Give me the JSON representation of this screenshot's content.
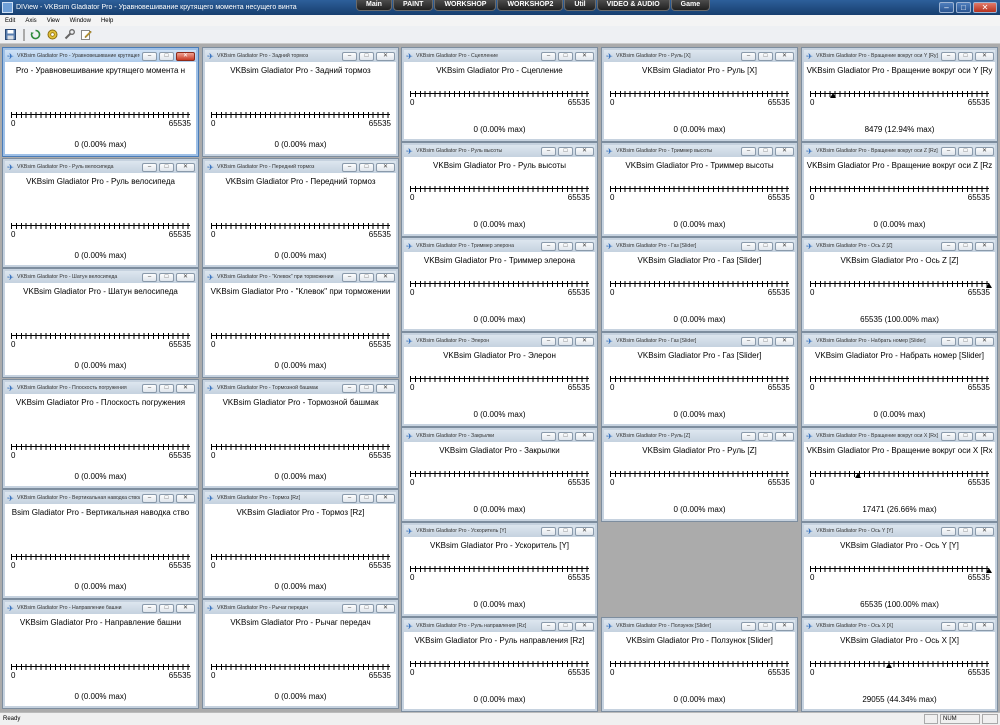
{
  "app": {
    "title": "DIView - VKBsim Gladiator Pro - Уравновешивание крутящего момента несущего винта"
  },
  "tabs": [
    "Main",
    "PAINT",
    "WORKSHOP",
    "WORKSHOP2",
    "Util",
    "VIDEO & AUDIO",
    "Game"
  ],
  "menu": [
    "Edit",
    "Axis",
    "View",
    "Window",
    "Help"
  ],
  "toolbar": [
    "save-icon",
    "refresh-icon",
    "settings-icon",
    "wrench-icon",
    "edit-icon"
  ],
  "status": {
    "text": "Ready",
    "num": "NUM"
  },
  "axis_min": "0",
  "axis_max": "65535",
  "windows": [
    {
      "title": "VKBsim Gladiator Pro - Уравновешивание крутящего момента несущего винта",
      "label": "Pro - Уравновешивание крутящего момента н",
      "value": "0 (0.00% max)",
      "marker": null,
      "active": true
    },
    {
      "title": "VKBsim Gladiator Pro - Задний тормоз",
      "label": "VKBsim Gladiator Pro - Задний тормоз",
      "value": "0 (0.00% max)",
      "marker": null
    },
    {
      "title": "VKBsim Gladiator Pro - Руль велосипеда",
      "label": "VKBsim Gladiator Pro - Руль велосипеда",
      "value": "0 (0.00% max)",
      "marker": null
    },
    {
      "title": "VKBsim Gladiator Pro - Передний тормоз",
      "label": "VKBsim Gladiator Pro - Передний тормоз",
      "value": "0 (0.00% max)",
      "marker": null
    },
    {
      "title": "VKBsim Gladiator Pro - Шатун велосипеда",
      "label": "VKBsim Gladiator Pro - Шатун велосипеда",
      "value": "0 (0.00% max)",
      "marker": null
    },
    {
      "title": "VKBsim Gladiator Pro - \"Клевок\" при торможении",
      "label": "VKBsim Gladiator Pro - \"Клевок\" при торможении",
      "value": "0 (0.00% max)",
      "marker": null
    },
    {
      "title": "VKBsim Gladiator Pro - Плоскость погружения",
      "label": "VKBsim Gladiator Pro - Плоскость погружения",
      "value": "0 (0.00% max)",
      "marker": null
    },
    {
      "title": "VKBsim Gladiator Pro - Тормозной башмак",
      "label": "VKBsim Gladiator Pro - Тормозной башмак",
      "value": "0 (0.00% max)",
      "marker": null
    },
    {
      "title": "VKBsim Gladiator Pro - Вертикальная наводка ствола",
      "label": "Bsim Gladiator Pro - Вертикальная наводка ство",
      "value": "0 (0.00% max)",
      "marker": null
    },
    {
      "title": "VKBsim Gladiator Pro - Тормоз [Rz]",
      "label": "VKBsim Gladiator Pro - Тормоз [Rz]",
      "value": "0 (0.00% max)",
      "marker": null
    },
    {
      "title": "VKBsim Gladiator Pro - Направление башни",
      "label": "VKBsim Gladiator Pro - Направление башни",
      "value": "0 (0.00% max)",
      "marker": null
    },
    {
      "title": "VKBsim Gladiator Pro - Рычаг передач",
      "label": "VKBsim Gladiator Pro - Рычаг передач",
      "value": "0 (0.00% max)",
      "marker": null
    },
    {
      "title": "VKBsim Gladiator Pro - Сцепление",
      "label": "VKBsim Gladiator Pro - Сцепление",
      "value": "0 (0.00% max)",
      "marker": null
    },
    {
      "title": "VKBsim Gladiator Pro - Руль высоты",
      "label": "VKBsim Gladiator Pro - Руль высоты",
      "value": "0 (0.00% max)",
      "marker": null
    },
    {
      "title": "VKBsim Gladiator Pro - Триммер элерона",
      "label": "VKBsim Gladiator Pro - Триммер элерона",
      "value": "0 (0.00% max)",
      "marker": null
    },
    {
      "title": "VKBsim Gladiator Pro - Элерон",
      "label": "VKBsim Gladiator Pro - Элерон",
      "value": "0 (0.00% max)",
      "marker": null
    },
    {
      "title": "VKBsim Gladiator Pro - Закрылки",
      "label": "VKBsim Gladiator Pro - Закрылки",
      "value": "0 (0.00% max)",
      "marker": null
    },
    {
      "title": "VKBsim Gladiator Pro - Ускоритель [Y]",
      "label": "VKBsim Gladiator Pro - Ускоритель [Y]",
      "value": "0 (0.00% max)",
      "marker": null
    },
    {
      "title": "VKBsim Gladiator Pro - Руль направления [Rz]",
      "label": "VKBsim Gladiator Pro - Руль направления [Rz]",
      "value": "0 (0.00% max)",
      "marker": null
    },
    {
      "title": "VKBsim Gladiator Pro - Руль [X]",
      "label": "VKBsim Gladiator Pro - Руль [X]",
      "value": "0 (0.00% max)",
      "marker": null
    },
    {
      "title": "VKBsim Gladiator Pro - Триммер высоты",
      "label": "VKBsim Gladiator Pro - Триммер высоты",
      "value": "0 (0.00% max)",
      "marker": null
    },
    {
      "title": "VKBsim Gladiator Pro - Газ [Slider]",
      "label": "VKBsim Gladiator Pro - Газ [Slider]",
      "value": "0 (0.00% max)",
      "marker": null
    },
    {
      "title": "VKBsim Gladiator Pro - Газ [Slider]",
      "label": "VKBsim Gladiator Pro - Газ [Slider]",
      "value": "0 (0.00% max)",
      "marker": null
    },
    {
      "title": "VKBsim Gladiator Pro - Руль [Z]",
      "label": "VKBsim Gladiator Pro - Руль [Z]",
      "value": "0 (0.00% max)",
      "marker": null
    },
    {
      "title": "VKBsim Gladiator Pro - Ползунок [Slider]",
      "label": "VKBsim Gladiator Pro - Ползунок [Slider]",
      "value": "0 (0.00% max)",
      "marker": null
    },
    {
      "title": "VKBsim Gladiator Pro - Вращение вокруг оси Y [Ry]",
      "label": "VKBsim Gladiator Pro - Вращение вокруг оси Y [Ry",
      "value": "8479 (12.94% max)",
      "marker": 0.1294
    },
    {
      "title": "VKBsim Gladiator Pro - Вращение вокруг оси Z [Rz]",
      "label": "VKBsim Gladiator Pro - Вращение вокруг оси Z [Rz",
      "value": "0 (0.00% max)",
      "marker": null
    },
    {
      "title": "VKBsim Gladiator Pro - Ось Z [Z]",
      "label": "VKBsim Gladiator Pro - Ось Z [Z]",
      "value": "65535 (100.00% max)",
      "marker": 1.0
    },
    {
      "title": "VKBsim Gladiator Pro - Набрать номер [Slider]",
      "label": "VKBsim Gladiator Pro - Набрать номер [Slider]",
      "value": "0 (0.00% max)",
      "marker": null
    },
    {
      "title": "VKBsim Gladiator Pro - Вращение вокруг оси X [Rx]",
      "label": "VKBsim Gladiator Pro - Вращение вокруг оси X [Rx",
      "value": "17471 (26.66% max)",
      "marker": 0.2666
    },
    {
      "title": "VKBsim Gladiator Pro - Ось Y [Y]",
      "label": "VKBsim Gladiator Pro - Ось Y [Y]",
      "value": "65535 (100.00% max)",
      "marker": 1.0
    },
    {
      "title": "VKBsim Gladiator Pro - Ось X [X]",
      "label": "VKBsim Gladiator Pro - Ось X [X]",
      "value": "29055 (44.34% max)",
      "marker": 0.4434
    }
  ]
}
